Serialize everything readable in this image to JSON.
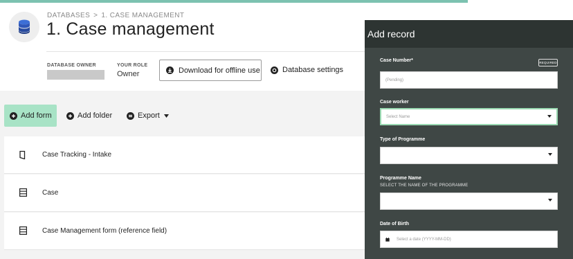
{
  "breadcrumb": {
    "root": "DATABASES",
    "separator": ">",
    "current": "1. CASE MANAGEMENT"
  },
  "page_title": "1. Case management",
  "meta": {
    "owner_label": "DATABASE OWNER",
    "role_label": "YOUR ROLE",
    "role_value": "Owner"
  },
  "actions": {
    "download_label": "Download for offline use",
    "settings_label": "Database settings"
  },
  "toolbar": {
    "add_form": "Add form",
    "add_folder": "Add folder",
    "export": "Export"
  },
  "forms": [
    {
      "label": "Case Tracking - Intake",
      "icon": "form-icon"
    },
    {
      "label": "Case",
      "icon": "table-icon"
    },
    {
      "label": "Case Management form (reference field)",
      "icon": "table-icon"
    }
  ],
  "panel": {
    "title": "Add record",
    "fields": {
      "case_number": {
        "label": "Case Number*",
        "badge": "REQUIRED",
        "placeholder": "(Pending)"
      },
      "case_worker": {
        "label": "Case worker",
        "placeholder": "Select Name"
      },
      "programme_type": {
        "label": "Type of Programme",
        "value": ""
      },
      "programme_name": {
        "label": "Programme Name",
        "sublabel": "SELECT THE NAME OF THE PROGRAMME",
        "value": ""
      },
      "dob": {
        "label": "Date of Birth",
        "placeholder": "Select a date (YYYY-MM-DD)"
      }
    }
  },
  "colors": {
    "accent": "#a8e3c6",
    "panel": "#3f4745",
    "panel_header": "#2d3432",
    "top_bar": "#7cc2b0"
  }
}
